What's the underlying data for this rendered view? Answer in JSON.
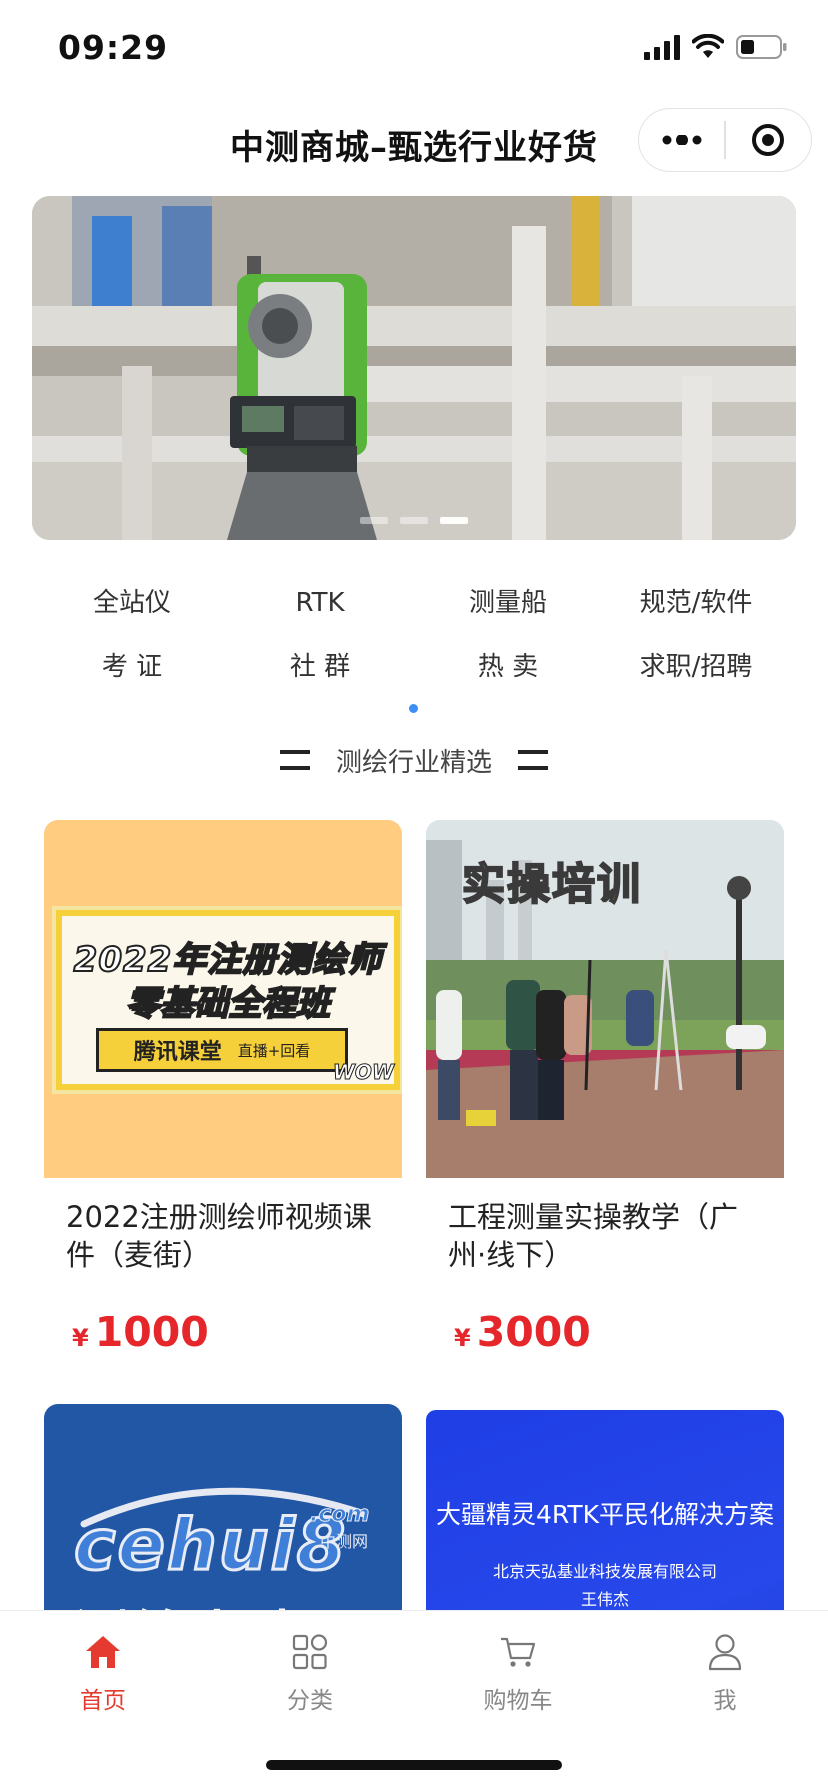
{
  "status_bar": {
    "time": "09:29"
  },
  "header": {
    "title": "中测商城–甄选行业好货"
  },
  "banner": {
    "slide_count": 3,
    "active_slide": 3
  },
  "categories": [
    {
      "label": "全站仪"
    },
    {
      "label": "RTK"
    },
    {
      "label": "测量船"
    },
    {
      "label": "规范/软件"
    },
    {
      "label": "考 证"
    },
    {
      "label": "社 群"
    },
    {
      "label": "热 卖"
    },
    {
      "label": "求职/招聘"
    }
  ],
  "section": {
    "title": "测绘行业精选"
  },
  "products": [
    {
      "image_text": {
        "line1": "2022年注册测绘师",
        "line2": "零基础全程班",
        "badge": "腾讯课堂",
        "badge_sub": "直播+回看",
        "wow": "WOW"
      },
      "title": "2022注册测绘师视频课件（麦街）",
      "currency": "¥",
      "price": "1000"
    },
    {
      "image_text": {
        "caption": "实操培训"
      },
      "title": "工程测量实操教学（广州·线下）",
      "currency": "¥",
      "price": "3000"
    },
    {
      "image_text": {
        "logo": "cehui8",
        "logo_small": ".com",
        "logo_sub": "中测网",
        "banner": "测绘人才网"
      }
    },
    {
      "image_text": {
        "headline": "大疆精灵4RTK平民化解决方案",
        "company": "北京天弘基业科技发展有限公司",
        "person": "王伟杰"
      }
    }
  ],
  "tab_bar": {
    "items": [
      {
        "label": "首页",
        "icon": "home-icon",
        "active": true
      },
      {
        "label": "分类",
        "icon": "category-icon",
        "active": false
      },
      {
        "label": "购物车",
        "icon": "cart-icon",
        "active": false
      },
      {
        "label": "我",
        "icon": "user-icon",
        "active": false
      }
    ],
    "active_color": "#e53a2f"
  },
  "colors": {
    "price": "#e5262a",
    "indicator": "#3b8ff5"
  }
}
